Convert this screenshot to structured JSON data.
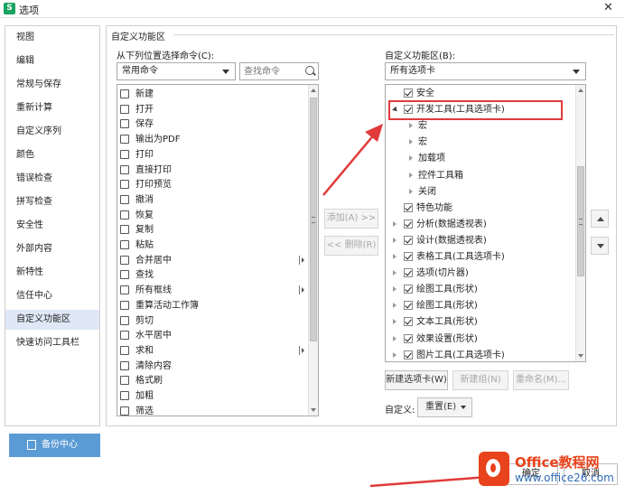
{
  "window": {
    "title": "选项",
    "app_icon_glyph": "S",
    "close_glyph": "✕"
  },
  "nav": {
    "items": [
      "视图",
      "编辑",
      "常规与保存",
      "重新计算",
      "自定义序列",
      "颜色",
      "错误检查",
      "拼写检查",
      "安全性",
      "外部内容",
      "新特性",
      "信任中心",
      "自定义功能区",
      "快速访问工具栏"
    ],
    "selected": "自定义功能区",
    "backup_label": "备份中心"
  },
  "group": {
    "title": "自定义功能区"
  },
  "left_pane": {
    "label": "从下列位置选择命令(C):",
    "combo_value": "常用命令",
    "search_placeholder": "查找命令",
    "commands": [
      "新建",
      "打开",
      "保存",
      "输出为PDF",
      "打印",
      "直接打印",
      "打印预览",
      "撤消",
      "恢复",
      "复制",
      "粘贴",
      "合并居中",
      "查找",
      "所有框线",
      "重算活动工作簿",
      "剪切",
      "水平居中",
      "求和",
      "清除内容",
      "格式刷",
      "加粗",
      "筛选"
    ],
    "commands_with_submenu": [
      "合并居中",
      "所有框线",
      "求和"
    ]
  },
  "middle": {
    "add_label": "添加(A) >>",
    "remove_label": "<< 删除(R)"
  },
  "right_pane": {
    "label": "自定义功能区(B):",
    "combo_value": "所有选项卡",
    "tree": [
      {
        "text": "安全",
        "level": 1,
        "checked": true,
        "expander": "none"
      },
      {
        "text": "开发工具(工具选项卡)",
        "level": 1,
        "checked": true,
        "expander": "open"
      },
      {
        "text": "宏",
        "level": 2,
        "checked": false,
        "expander": "closed"
      },
      {
        "text": "宏",
        "level": 2,
        "checked": false,
        "expander": "closed"
      },
      {
        "text": "加载项",
        "level": 2,
        "checked": false,
        "expander": "closed"
      },
      {
        "text": "控件工具箱",
        "level": 2,
        "checked": false,
        "expander": "closed"
      },
      {
        "text": "关闭",
        "level": 2,
        "checked": false,
        "expander": "closed"
      },
      {
        "text": "特色功能",
        "level": 1,
        "checked": true,
        "expander": "none"
      },
      {
        "text": "分析(数据透视表)",
        "level": 1,
        "checked": true,
        "expander": "closed"
      },
      {
        "text": "设计(数据透视表)",
        "level": 1,
        "checked": true,
        "expander": "closed"
      },
      {
        "text": "表格工具(工具选项卡)",
        "level": 1,
        "checked": true,
        "expander": "closed"
      },
      {
        "text": "选项(切片器)",
        "level": 1,
        "checked": true,
        "expander": "closed"
      },
      {
        "text": "绘图工具(形状)",
        "level": 1,
        "checked": true,
        "expander": "closed"
      },
      {
        "text": "绘图工具(形状)",
        "level": 1,
        "checked": true,
        "expander": "closed"
      },
      {
        "text": "文本工具(形状)",
        "level": 1,
        "checked": true,
        "expander": "closed"
      },
      {
        "text": "效果设置(形状)",
        "level": 1,
        "checked": true,
        "expander": "closed"
      },
      {
        "text": "图片工具(工具选项卡)",
        "level": 1,
        "checked": true,
        "expander": "closed"
      }
    ],
    "new_tab_label": "新建选项卡(W)",
    "new_group_label": "新建组(N)",
    "rename_label": "重命名(M)...",
    "customize_label": "自定义:",
    "reset_label": "重置(E)"
  },
  "footer": {
    "ok_label": "确定",
    "cancel_label": "取消"
  },
  "watermark": {
    "line1": "Office教程网",
    "line2": "www.office26.com"
  },
  "colors": {
    "accent": "#5b9bd5",
    "highlight": "#e03a3a",
    "selected_nav": "#dfe8f6",
    "logo": "#e8431c"
  }
}
